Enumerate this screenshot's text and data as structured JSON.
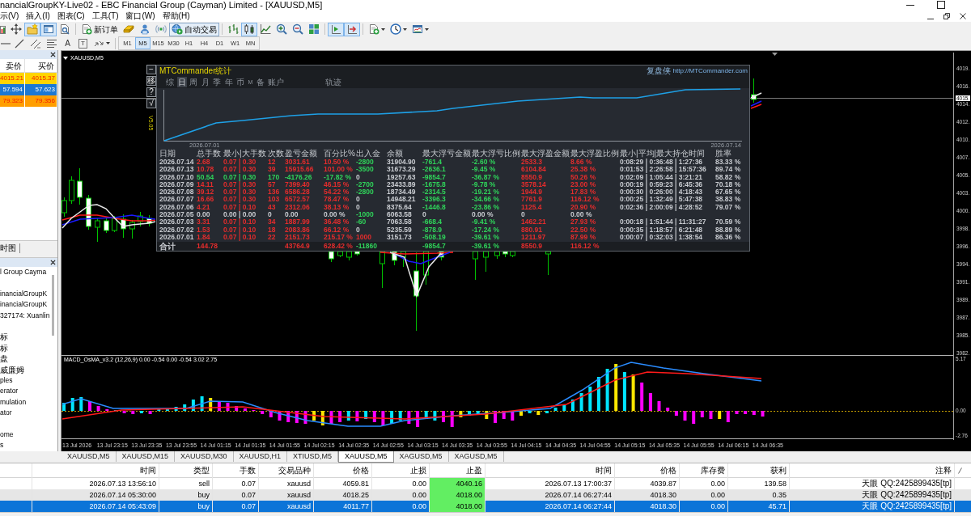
{
  "window": {
    "title": "nancialGroupKY-Live02 - EBC Financial Group (Cayman) Limited - [XAUUSD,M5]"
  },
  "menu": [
    "示(V)",
    "插入(I)",
    "图表(C)",
    "工具(T)",
    "窗口(W)",
    "帮助(H)"
  ],
  "toolbar": {
    "window_toggles": [
      {
        "on": true
      },
      {
        "on": true
      },
      {
        "on": false
      }
    ],
    "new_order": "新订单",
    "auto_trading": {
      "label": "自动交易",
      "on": true
    },
    "chart_types": [
      {
        "selected": false
      },
      {
        "selected": true
      },
      {
        "selected": false
      }
    ],
    "chart_shift": {
      "on": true
    },
    "auto_scroll": {
      "on": true
    }
  },
  "drawing_tools": {
    "text_tool": "A",
    "label_tool": "T"
  },
  "timeframes": [
    {
      "label": "M1",
      "selected": false
    },
    {
      "label": "M5",
      "selected": true
    },
    {
      "label": "M15",
      "selected": false
    },
    {
      "label": "M30",
      "selected": false
    },
    {
      "label": "H1",
      "selected": false
    },
    {
      "label": "H4",
      "selected": false
    },
    {
      "label": "D1",
      "selected": false
    },
    {
      "label": "W1",
      "selected": false
    },
    {
      "label": "MN",
      "selected": false
    }
  ],
  "market_watch": {
    "columns": [
      "卖价",
      "买价"
    ],
    "rows": [
      {
        "bid": "4015.21",
        "ask": "4015.37",
        "color": "#ffd400"
      },
      {
        "bid": "57.594",
        "ask": "57.623",
        "color": "#1c78d4"
      },
      {
        "bid": "79.323",
        "ask": "79.356",
        "color": "#ff9e00"
      }
    ]
  },
  "market_watch_tab": {
    "label": "时图"
  },
  "navigator": {
    "sections": [
      {
        "items": [
          "l Group Cayma"
        ]
      },
      {
        "items": [
          "inancialGroupK",
          "inancialGroupK",
          "327174: Xuanlin"
        ]
      },
      {
        "items": [
          "标",
          "标",
          "盘",
          "威廉姆",
          "ples",
          "erator",
          "mulation",
          "ator"
        ]
      },
      {
        "items": [
          "ome",
          "s"
        ]
      }
    ]
  },
  "chart": {
    "title": "XAUUSD,M5",
    "price_axis": [
      "4019.",
      "4016.",
      "4014.",
      "4012.",
      "4010.",
      "4007.",
      "4005.",
      "4003.",
      "4000.",
      "3998.",
      "3996.",
      "3994.",
      "3991.",
      "3989.",
      "3987.",
      "3985.",
      "3982."
    ],
    "current_price": "4015.",
    "indicator": {
      "title": "MACD_OsMA_v3.2 (12,26,9) 0.00 -0.54 0.00 -0.54 3.02 2.75",
      "axis": [
        "5.17",
        "0.00",
        "-2.76"
      ]
    },
    "time_axis": [
      "13 Jul 2026",
      "13 Jul 23:15",
      "13 Jul 23:35",
      "13 Jul 23:55",
      "14 Jul 01:15",
      "14 Jul 01:35",
      "14 Jul 01:55",
      "14 Jul 02:15",
      "14 Jul 02:35",
      "14 Jul 02:55",
      "14 Jul 03:15",
      "14 Jul 03:35",
      "14 Jul 03:55",
      "14 Jul 04:15",
      "14 Jul 04:35",
      "14 Jul 04:55",
      "14 Jul 05:15",
      "14 Jul 05:35",
      "14 Jul 05:55",
      "14 Jul 06:15",
      "14 Jul 06:35"
    ]
  },
  "stats_panel": {
    "title": "MTCommander统计",
    "brand": "复盘侠",
    "link": "http://MTCommander.com",
    "side_buttons": [
      "−",
      "移",
      "?",
      "√"
    ],
    "version": "V5.05",
    "tabs": [
      {
        "label": "综",
        "selected": false
      },
      {
        "label": "日",
        "selected": true
      },
      {
        "label": "周",
        "selected": false
      },
      {
        "label": "月",
        "selected": false
      },
      {
        "label": "季",
        "selected": false
      },
      {
        "label": "年",
        "selected": false
      },
      {
        "label": "币",
        "selected": false
      },
      {
        "label": "M",
        "selected": false
      },
      {
        "label": "备",
        "selected": false
      },
      {
        "label": "账户",
        "selected": false
      }
    ],
    "extra_tabs": [
      {
        "label": "轨迹",
        "selected": false
      }
    ],
    "curve": {
      "start_label": "2026.07.01",
      "end_label": "2026.07.14"
    },
    "table": {
      "columns": [
        "日期",
        "总手数",
        "最小|大手数",
        "次数",
        "盈亏金额",
        "百分比%",
        "出入金",
        "余额",
        "最大浮亏金额",
        "最大浮亏比例",
        "最大浮盈金额",
        "最大浮盈比例",
        "最小|平均|最大持仓时间",
        "胜率"
      ],
      "rows": [
        {
          "cells": [
            {
              "text": "2026.07.14",
              "color": "#c9ccd1"
            },
            {
              "text": "2.68",
              "color": "#e42c2c"
            },
            {
              "text": "0.07 | 0.30",
              "color": "#e42c2c"
            },
            {
              "text": "12",
              "color": "#e42c2c"
            },
            {
              "text": "3031.61",
              "color": "#e42c2c"
            },
            {
              "text": "10.50 %",
              "color": "#e42c2c"
            },
            {
              "text": "-2800",
              "color": "#2fd35a"
            },
            {
              "text": "31904.90",
              "color": "#c9ccd1"
            },
            {
              "text": "-761.4",
              "color": "#2fd35a"
            },
            {
              "text": "-2.60 %",
              "color": "#2fd35a"
            },
            {
              "text": "2533.3",
              "color": "#e42c2c"
            },
            {
              "text": "8.66 %",
              "color": "#e42c2c"
            },
            {
              "text": "0:08:29 | 0:36:48 | 1:27:36",
              "color": "#c9ccd1"
            },
            {
              "text": "83.33 %",
              "color": "#c9ccd1"
            }
          ]
        },
        {
          "cells": [
            {
              "text": "2026.07.13",
              "color": "#c9ccd1"
            },
            {
              "text": "10.78",
              "color": "#e42c2c"
            },
            {
              "text": "0.07 | 0.30",
              "color": "#e42c2c"
            },
            {
              "text": "39",
              "color": "#e42c2c"
            },
            {
              "text": "15915.66",
              "color": "#e42c2c"
            },
            {
              "text": "101.00 %",
              "color": "#e42c2c"
            },
            {
              "text": "-3500",
              "color": "#2fd35a"
            },
            {
              "text": "31673.29",
              "color": "#c9ccd1"
            },
            {
              "text": "-2636.1",
              "color": "#2fd35a"
            },
            {
              "text": "-9.45 %",
              "color": "#2fd35a"
            },
            {
              "text": "6104.84",
              "color": "#e42c2c"
            },
            {
              "text": "25.38 %",
              "color": "#e42c2c"
            },
            {
              "text": "0:01:53 | 2:26:58 | 15:57:36",
              "color": "#c9ccd1"
            },
            {
              "text": "89.74 %",
              "color": "#c9ccd1"
            }
          ]
        },
        {
          "cells": [
            {
              "text": "2026.07.10",
              "color": "#c9ccd1"
            },
            {
              "text": "50.54",
              "color": "#2fd35a"
            },
            {
              "text": "0.07 | 0.30",
              "color": "#2fd35a"
            },
            {
              "text": "170",
              "color": "#2fd35a"
            },
            {
              "text": "-4176.26",
              "color": "#2fd35a"
            },
            {
              "text": "-17.82 %",
              "color": "#2fd35a"
            },
            {
              "text": "0",
              "color": "#c9ccd1"
            },
            {
              "text": "19257.63",
              "color": "#c9ccd1"
            },
            {
              "text": "-9854.7",
              "color": "#2fd35a"
            },
            {
              "text": "-36.87 %",
              "color": "#2fd35a"
            },
            {
              "text": "8550.9",
              "color": "#e42c2c"
            },
            {
              "text": "50.26 %",
              "color": "#e42c2c"
            },
            {
              "text": "0:02:09 | 1:05:44 | 3:21:21",
              "color": "#c9ccd1"
            },
            {
              "text": "58.82 %",
              "color": "#c9ccd1"
            }
          ]
        },
        {
          "cells": [
            {
              "text": "2026.07.09",
              "color": "#c9ccd1"
            },
            {
              "text": "14.11",
              "color": "#e42c2c"
            },
            {
              "text": "0.07 | 0.30",
              "color": "#e42c2c"
            },
            {
              "text": "57",
              "color": "#e42c2c"
            },
            {
              "text": "7399.40",
              "color": "#e42c2c"
            },
            {
              "text": "46.15 %",
              "color": "#e42c2c"
            },
            {
              "text": "-2700",
              "color": "#2fd35a"
            },
            {
              "text": "23433.89",
              "color": "#c9ccd1"
            },
            {
              "text": "-1675.8",
              "color": "#2fd35a"
            },
            {
              "text": "-9.78 %",
              "color": "#2fd35a"
            },
            {
              "text": "3578.14",
              "color": "#e42c2c"
            },
            {
              "text": "23.00 %",
              "color": "#e42c2c"
            },
            {
              "text": "0:00:19 | 0:59:23 | 6:45:36",
              "color": "#c9ccd1"
            },
            {
              "text": "70.18 %",
              "color": "#c9ccd1"
            }
          ]
        },
        {
          "cells": [
            {
              "text": "2026.07.08",
              "color": "#c9ccd1"
            },
            {
              "text": "39.12",
              "color": "#e42c2c"
            },
            {
              "text": "0.07 | 0.30",
              "color": "#e42c2c"
            },
            {
              "text": "136",
              "color": "#e42c2c"
            },
            {
              "text": "6586.28",
              "color": "#e42c2c"
            },
            {
              "text": "54.22 %",
              "color": "#e42c2c"
            },
            {
              "text": "-2800",
              "color": "#2fd35a"
            },
            {
              "text": "18734.49",
              "color": "#c9ccd1"
            },
            {
              "text": "-2314.5",
              "color": "#2fd35a"
            },
            {
              "text": "-19.21 %",
              "color": "#2fd35a"
            },
            {
              "text": "1944.9",
              "color": "#e42c2c"
            },
            {
              "text": "17.83 %",
              "color": "#e42c2c"
            },
            {
              "text": "0:00:30 | 0:26:00 | 4:18:43",
              "color": "#c9ccd1"
            },
            {
              "text": "67.65 %",
              "color": "#c9ccd1"
            }
          ]
        },
        {
          "cells": [
            {
              "text": "2026.07.07",
              "color": "#c9ccd1"
            },
            {
              "text": "16.66",
              "color": "#e42c2c"
            },
            {
              "text": "0.07 | 0.30",
              "color": "#e42c2c"
            },
            {
              "text": "103",
              "color": "#e42c2c"
            },
            {
              "text": "6572.57",
              "color": "#e42c2c"
            },
            {
              "text": "78.47 %",
              "color": "#e42c2c"
            },
            {
              "text": "0",
              "color": "#c9ccd1"
            },
            {
              "text": "14948.21",
              "color": "#c9ccd1"
            },
            {
              "text": "-3396.3",
              "color": "#2fd35a"
            },
            {
              "text": "-34.66 %",
              "color": "#2fd35a"
            },
            {
              "text": "7761.9",
              "color": "#e42c2c"
            },
            {
              "text": "116.12 %",
              "color": "#e42c2c"
            },
            {
              "text": "0:00:25 | 1:32:49 | 5:47:38",
              "color": "#c9ccd1"
            },
            {
              "text": "38.83 %",
              "color": "#c9ccd1"
            }
          ]
        },
        {
          "cells": [
            {
              "text": "2026.07.06",
              "color": "#c9ccd1"
            },
            {
              "text": "4.21",
              "color": "#e42c2c"
            },
            {
              "text": "0.07 | 0.10",
              "color": "#e42c2c"
            },
            {
              "text": "43",
              "color": "#e42c2c"
            },
            {
              "text": "2312.06",
              "color": "#e42c2c"
            },
            {
              "text": "38.13 %",
              "color": "#e42c2c"
            },
            {
              "text": "0",
              "color": "#c9ccd1"
            },
            {
              "text": "8375.64",
              "color": "#c9ccd1"
            },
            {
              "text": "-1446.8",
              "color": "#2fd35a"
            },
            {
              "text": "-23.86 %",
              "color": "#2fd35a"
            },
            {
              "text": "1125.4",
              "color": "#e42c2c"
            },
            {
              "text": "20.90 %",
              "color": "#e42c2c"
            },
            {
              "text": "0:02:36 | 2:00:09 | 4:28:52",
              "color": "#c9ccd1"
            },
            {
              "text": "79.07 %",
              "color": "#c9ccd1"
            }
          ]
        },
        {
          "cells": [
            {
              "text": "2026.07.05",
              "color": "#c9ccd1"
            },
            {
              "text": "0.00",
              "color": "#c9ccd1"
            },
            {
              "text": "0.00 | 0.00",
              "color": "#c9ccd1"
            },
            {
              "text": "0",
              "color": "#c9ccd1"
            },
            {
              "text": "0.00",
              "color": "#c9ccd1"
            },
            {
              "text": "0.00 %",
              "color": "#c9ccd1"
            },
            {
              "text": "-1000",
              "color": "#2fd35a"
            },
            {
              "text": "6063.58",
              "color": "#c9ccd1"
            },
            {
              "text": "0",
              "color": "#c9ccd1"
            },
            {
              "text": "0.00 %",
              "color": "#c9ccd1"
            },
            {
              "text": "0",
              "color": "#c9ccd1"
            },
            {
              "text": "0.00 %",
              "color": "#c9ccd1"
            }
          ]
        },
        {
          "cells": [
            {
              "text": "2026.07.03",
              "color": "#c9ccd1"
            },
            {
              "text": "3.31",
              "color": "#e42c2c"
            },
            {
              "text": "0.07 | 0.10",
              "color": "#e42c2c"
            },
            {
              "text": "34",
              "color": "#e42c2c"
            },
            {
              "text": "1887.99",
              "color": "#e42c2c"
            },
            {
              "text": "36.48 %",
              "color": "#e42c2c"
            },
            {
              "text": "-60",
              "color": "#2fd35a"
            },
            {
              "text": "7063.58",
              "color": "#c9ccd1"
            },
            {
              "text": "-668.4",
              "color": "#2fd35a"
            },
            {
              "text": "-9.41 %",
              "color": "#2fd35a"
            },
            {
              "text": "1462.21",
              "color": "#e42c2c"
            },
            {
              "text": "27.93 %",
              "color": "#e42c2c"
            },
            {
              "text": "0:00:18 | 1:51:44 | 11:31:27",
              "color": "#c9ccd1"
            },
            {
              "text": "70.59 %",
              "color": "#c9ccd1"
            }
          ]
        },
        {
          "cells": [
            {
              "text": "2026.07.02",
              "color": "#c9ccd1"
            },
            {
              "text": "1.53",
              "color": "#e42c2c"
            },
            {
              "text": "0.07 | 0.10",
              "color": "#e42c2c"
            },
            {
              "text": "18",
              "color": "#e42c2c"
            },
            {
              "text": "2083.86",
              "color": "#e42c2c"
            },
            {
              "text": "66.12 %",
              "color": "#e42c2c"
            },
            {
              "text": "0",
              "color": "#c9ccd1"
            },
            {
              "text": "5235.59",
              "color": "#c9ccd1"
            },
            {
              "text": "-878.9",
              "color": "#2fd35a"
            },
            {
              "text": "-17.24 %",
              "color": "#2fd35a"
            },
            {
              "text": "880.91",
              "color": "#e42c2c"
            },
            {
              "text": "22.50 %",
              "color": "#e42c2c"
            },
            {
              "text": "0:00:35 | 1:18:57 | 6:21:48",
              "color": "#c9ccd1"
            },
            {
              "text": "88.89 %",
              "color": "#c9ccd1"
            }
          ]
        },
        {
          "cells": [
            {
              "text": "2026.07.01",
              "color": "#c9ccd1"
            },
            {
              "text": "1.84",
              "color": "#e42c2c"
            },
            {
              "text": "0.07 | 0.10",
              "color": "#e42c2c"
            },
            {
              "text": "22",
              "color": "#e42c2c"
            },
            {
              "text": "2151.73",
              "color": "#e42c2c"
            },
            {
              "text": "215.17 %",
              "color": "#e42c2c"
            },
            {
              "text": "1000",
              "color": "#e42c2c"
            },
            {
              "text": "3151.73",
              "color": "#c9ccd1"
            },
            {
              "text": "-508.19",
              "color": "#2fd35a"
            },
            {
              "text": "-39.61 %",
              "color": "#2fd35a"
            },
            {
              "text": "1211.97",
              "color": "#e42c2c"
            },
            {
              "text": "87.99 %",
              "color": "#e42c2c"
            },
            {
              "text": "0:00:07 | 0:32:03 | 1:38:54",
              "color": "#c9ccd1"
            },
            {
              "text": "86.36 %",
              "color": "#c9ccd1"
            }
          ]
        }
      ],
      "total": {
        "cells": [
          {
            "text": "合计",
            "color": "#c9ccd1"
          },
          {
            "text": "144.78",
            "color": "#e42c2c"
          },
          null,
          null,
          {
            "text": "43764.9",
            "color": "#e42c2c"
          },
          {
            "text": "628.42 %",
            "color": "#e42c2c"
          },
          {
            "text": "-11860",
            "color": "#2fd35a"
          },
          null,
          {
            "text": "-9854.7",
            "color": "#2fd35a"
          },
          {
            "text": "-39.61 %",
            "color": "#2fd35a"
          },
          {
            "text": "8550.9",
            "color": "#e42c2c"
          },
          {
            "text": "116.12 %",
            "color": "#e42c2c"
          }
        ]
      }
    }
  },
  "chart_tabs": [
    {
      "label": "XAUUSD,M5",
      "selected": false
    },
    {
      "label": "XAUUSD,M15",
      "selected": false
    },
    {
      "label": "XAUUSD,M30",
      "selected": false
    },
    {
      "label": "XAUUSD,H1",
      "selected": false
    },
    {
      "label": "XTIUSD,M5",
      "selected": false
    },
    {
      "label": "XAUUSD,M5",
      "selected": true
    },
    {
      "label": "XAGUSD,M5",
      "selected": false
    },
    {
      "label": "XAGUSD,M5",
      "selected": false
    }
  ],
  "trades": {
    "columns": [
      "时间",
      "类型",
      "手数",
      "交易品种",
      "价格",
      "止损",
      "止盈",
      "时间",
      "价格",
      "库存费",
      "获利",
      "注释"
    ],
    "rows": [
      {
        "cells": [
          "2026.07.13 13:56:10",
          "sell",
          "0.07",
          "xauusd",
          "4059.81",
          "0.00",
          "4040.16",
          "2026.07.13 17:00:37",
          "4039.87",
          "0.00",
          "139.58",
          "天眼 QQ:2425899435[tp]"
        ],
        "tp_hit": true,
        "selected": false,
        "highlighted": false
      },
      {
        "cells": [
          "2026.07.14 05:30:00",
          "buy",
          "0.07",
          "xauusd",
          "4018.25",
          "0.00",
          "4018.00",
          "2026.07.14 06:27:44",
          "4018.30",
          "0.00",
          "0.35",
          "天眼 QQ:2425899435[tp]"
        ],
        "tp_hit": true,
        "selected": false,
        "highlighted": true
      },
      {
        "cells": [
          "2026.07.14 05:43:09",
          "buy",
          "0.07",
          "xauusd",
          "4011.77",
          "0.00",
          "4018.00",
          "2026.07.14 06:27:44",
          "4018.30",
          "0.00",
          "45.71",
          "天眼 QQ:2425899435[tp]"
        ],
        "tp_hit": true,
        "selected": true,
        "highlighted": false
      }
    ]
  }
}
